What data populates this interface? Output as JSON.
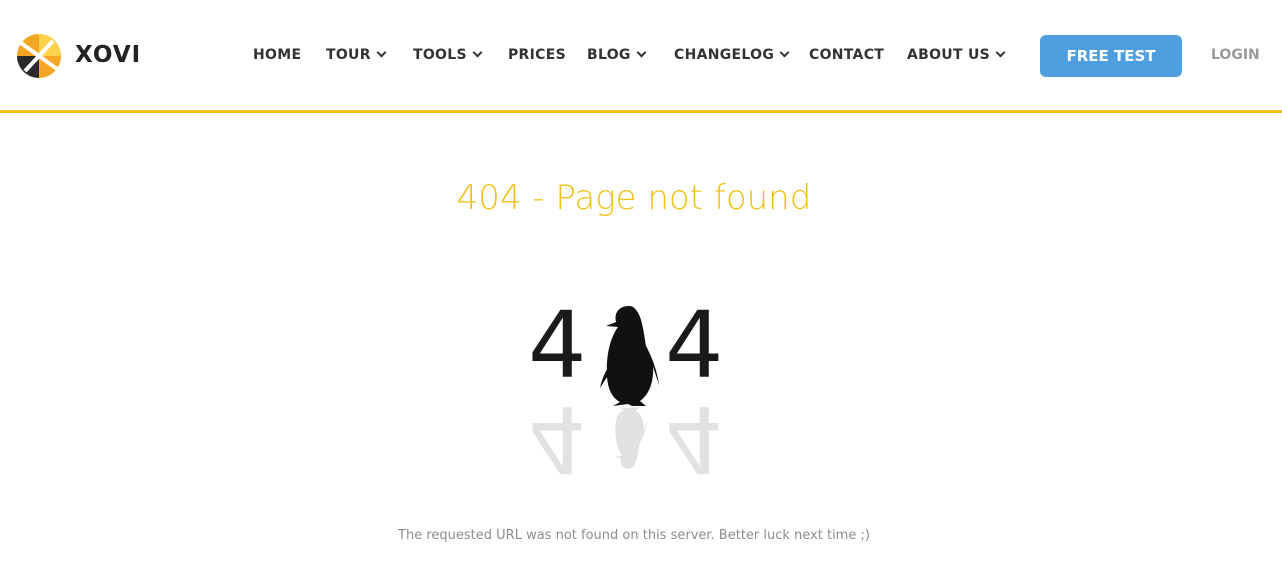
{
  "brand": {
    "name": "XOVI"
  },
  "nav": {
    "items": [
      {
        "label": "HOME",
        "dropdown": false
      },
      {
        "label": "TOUR",
        "dropdown": true
      },
      {
        "label": "TOOLS",
        "dropdown": true
      },
      {
        "label": "PRICES",
        "dropdown": false
      },
      {
        "label": "BLOG",
        "dropdown": true
      },
      {
        "label": "CHANGELOG",
        "dropdown": true
      },
      {
        "label": "CONTACT",
        "dropdown": false
      },
      {
        "label": "ABOUT US",
        "dropdown": true
      }
    ],
    "cta_label": "FREE TEST",
    "login_label": "LOGIN"
  },
  "page": {
    "title": "404 - Page not found",
    "message": "The requested URL was not found on this server. Better luck next time ;)"
  },
  "graphic": {
    "left_digit": "4",
    "right_digit": "4"
  },
  "colors": {
    "accent": "#f2c119",
    "button": "#4f9fe0",
    "text": "#333333"
  }
}
